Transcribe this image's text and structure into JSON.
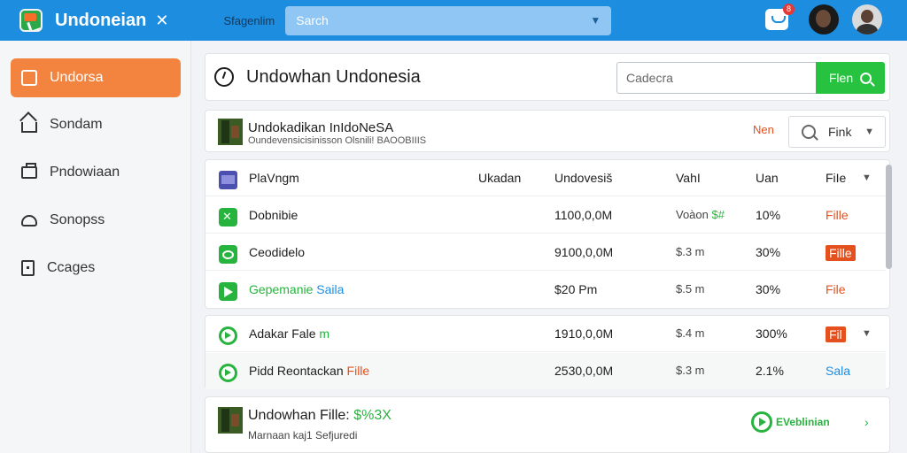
{
  "header": {
    "app_title": "Undoneian",
    "close_glyph": "✕",
    "search_label": "Sfagenlim",
    "search_placeholder": "Sarch",
    "notification_count": "8"
  },
  "sidebar": {
    "items": [
      {
        "label": "Undorsa",
        "icon": "box-icon",
        "active": true
      },
      {
        "label": "Sondam",
        "icon": "house-icon"
      },
      {
        "label": "Pndowiaan",
        "icon": "folder-icon"
      },
      {
        "label": "Sonopss",
        "icon": "cloud-icon"
      },
      {
        "label": "Ccages",
        "icon": "square-dot-icon"
      }
    ]
  },
  "main": {
    "page_title": "Undowhan Undonesia",
    "search_placeholder": "Cadecra",
    "filter_button": "Flen"
  },
  "info_card": {
    "title": "Undokadikan InIdoNeSA",
    "subtitle": "Oundevensicisinisson Olsnili! BAOOBIIIS",
    "new_label": "Nen",
    "filter_label": "Fink"
  },
  "table": {
    "header": {
      "name": "PlaVngm",
      "ukadan": "Ukadan",
      "undovesis": "Undovesiš",
      "vahl": "VahI",
      "uan": "Uan",
      "file": "FiIe"
    },
    "rows": [
      {
        "name": "Dobnibie",
        "size": "1100,0,0M",
        "value": "Voàon",
        "value_tag": "$#",
        "pct": "10%",
        "file": "Fille"
      },
      {
        "name": "Ceodidelo",
        "size": "9100,0,0M",
        "value": "$.3 m",
        "pct": "30%",
        "file": "Fille"
      },
      {
        "name": "Gepemanie",
        "name_tag": "Saila",
        "size": "$20 Pm",
        "value": "$.5 m",
        "pct": "30%",
        "file": "File"
      }
    ],
    "rows2": [
      {
        "name": "Adakar Fale",
        "name_tag": "m",
        "size": "1910,0,0M",
        "value": "$.4 m",
        "pct": "300%",
        "file": "Fil"
      },
      {
        "name": "Pidd Reontackan",
        "name_tag": "Fille",
        "size": "2530,0,0M",
        "value": "$.3 m",
        "pct": "2.1%",
        "file": "Sala"
      }
    ]
  },
  "footer_card": {
    "title": "Undowhan Fille:",
    "title_tag": "$%3X",
    "subtitle": "Marnaan kaj1 Sefjuredi",
    "brand": "EVeblinian"
  },
  "colors": {
    "topbar": "#1d8de0",
    "accent_orange": "#f2843f",
    "accent_green": "#27c240",
    "accent_red": "#e4511e"
  }
}
